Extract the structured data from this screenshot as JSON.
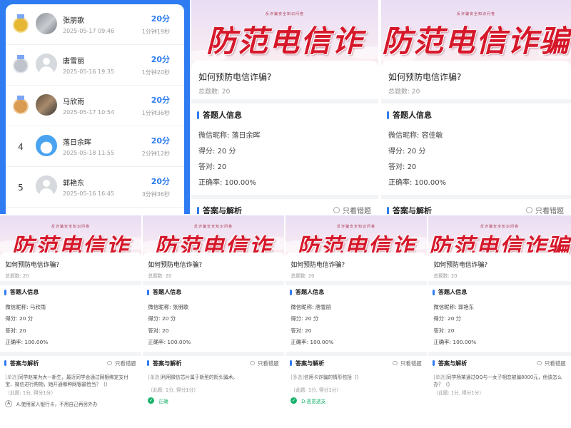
{
  "ranking": [
    {
      "rank": "",
      "medal": "gold",
      "name": "张朋歌",
      "time": "2025-05-17 09:46",
      "score": "20分",
      "duration": "1分钟19秒"
    },
    {
      "rank": "",
      "medal": "silver",
      "name": "唐雪丽",
      "time": "2025-05-16 19:35",
      "score": "20分",
      "duration": "1分钟20秒"
    },
    {
      "rank": "",
      "medal": "bronze",
      "name": "马欣雨",
      "time": "2025-05-17 10:54",
      "score": "20分",
      "duration": "1分钟36秒"
    },
    {
      "rank": "4",
      "medal": "none",
      "name": "落日余晖",
      "time": "2025-05-18 11:55",
      "score": "20分",
      "duration": "2分钟12秒"
    },
    {
      "rank": "5",
      "medal": "none",
      "name": "郭艳东",
      "time": "2025-05-16 16:45",
      "score": "20分",
      "duration": "3分钟36秒"
    }
  ],
  "common": {
    "banner_title": "防范电信诈骗",
    "banner_subtitle": "反诈骗安全知识问卷",
    "quiz_title": "如何预防电信诈骗?",
    "total_label": "总题数:",
    "total_value": "20",
    "info_heading": "答题人信息",
    "nickname_label": "微信昵称:",
    "score_label": "得分:",
    "correct_label": "答对:",
    "rate_label": "正确率:",
    "answer_heading": "答案与解析",
    "only_wrong": "只看错题",
    "accent_color": "#2f7cf2",
    "banner_color": "#d6182b"
  },
  "cards": [
    {
      "nickname": "落日余晖",
      "score": "20 分",
      "correct": "20",
      "rate": "100.00%",
      "answer_heading": "答案与解析"
    },
    {
      "nickname": "容佳敏",
      "score": "20 分",
      "correct": "20",
      "rate": "100.00%",
      "answer_heading": "答案与解析"
    },
    {
      "nickname": "马欣雨",
      "score": "20 分",
      "correct": "20",
      "rate": "100.00%",
      "q_tag": "[单选]",
      "q_text": "同学赵某为大一新生，最近同学会通过网银绑定支付宝、微信进行购物，她开通哪种网银最恰当？（）",
      "q_meta": "（此题: 1分, 得分1分）",
      "option_key": "A",
      "option_text": "A.使用家人银行卡，不用自己再另外办"
    },
    {
      "nickname": "张朋歌",
      "score": "20 分",
      "correct": "20",
      "rate": "100.00%",
      "q_tag": "[单选]",
      "q_text": "利用微信芯片属于新型的街头骗术。",
      "q_meta": "（此题: 1分, 得分1分）",
      "answer": "正确"
    },
    {
      "nickname": "唐雪丽",
      "score": "20 分",
      "correct": "20",
      "rate": "100.00%",
      "q_tag": "[多选]",
      "q_text": "信用卡诈骗的情形包括（）",
      "q_meta": "（此题: 1分, 得分1分）",
      "answer": "D.恶意透支"
    },
    {
      "nickname": "郭艳东",
      "score": "20 分",
      "correct": "20",
      "rate": "100.00%",
      "q_tag": "[单选]",
      "q_text": "同学杨某通过QQ与一女子相恋被骗8000元，他该怎么办？（）",
      "q_meta": "（此题: 1分, 得分1分）"
    }
  ]
}
